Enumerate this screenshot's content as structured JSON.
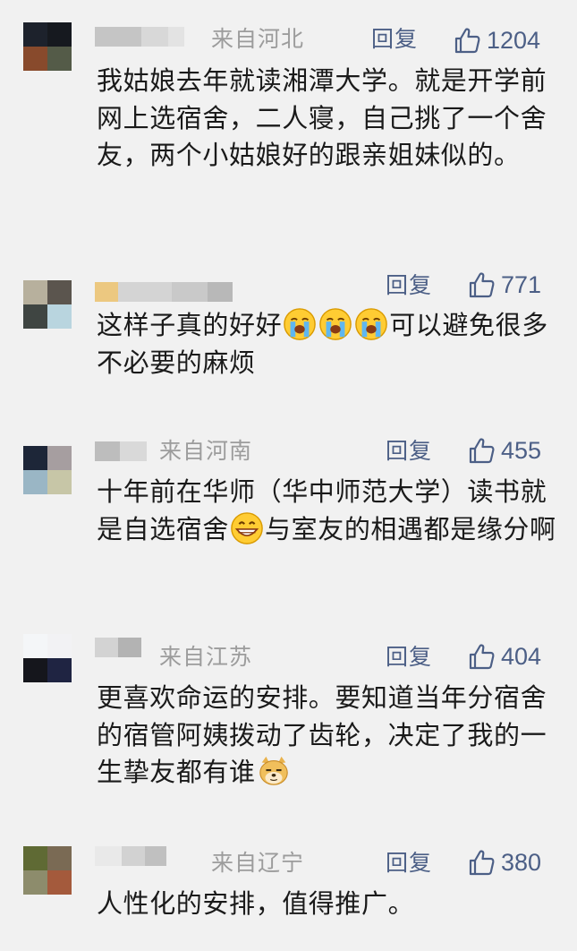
{
  "comments": [
    {
      "origin": "来自河北",
      "reply": "回复",
      "likes": "1204",
      "text": "我姑娘去年就读湘潭大学。就是开学前网上选宿舍，二人寝，自己挑了一个舍友，两个小姑娘好的跟亲姐妹似的。"
    },
    {
      "origin": "",
      "reply": "回复",
      "likes": "771",
      "text_a": "这样子真的好好",
      "text_b": "可以避免很多不必要的麻烦",
      "emoji": "loudly-crying-face-icon"
    },
    {
      "origin": "来自河南",
      "reply": "回复",
      "likes": "455",
      "text_a": "十年前在华师（华中师范大学）读书就是自选宿舍",
      "text_b": "与室友的相遇都是缘分啊",
      "emoji": "grinning-face-icon"
    },
    {
      "origin": "来自江苏",
      "reply": "回复",
      "likes": "404",
      "text_a": "更喜欢命运的安排。要知道当年分宿舍的宿管阿姨拨动了齿轮，决定了我的一生挚友都有谁",
      "emoji": "doge-icon"
    },
    {
      "origin": "来自辽宁",
      "reply": "回复",
      "likes": "380",
      "text": "人性化的安排，值得推广。"
    }
  ],
  "colors": {
    "background": "#f1f1f1",
    "action": "#4c5f86",
    "meta": "#9c9c9c"
  }
}
